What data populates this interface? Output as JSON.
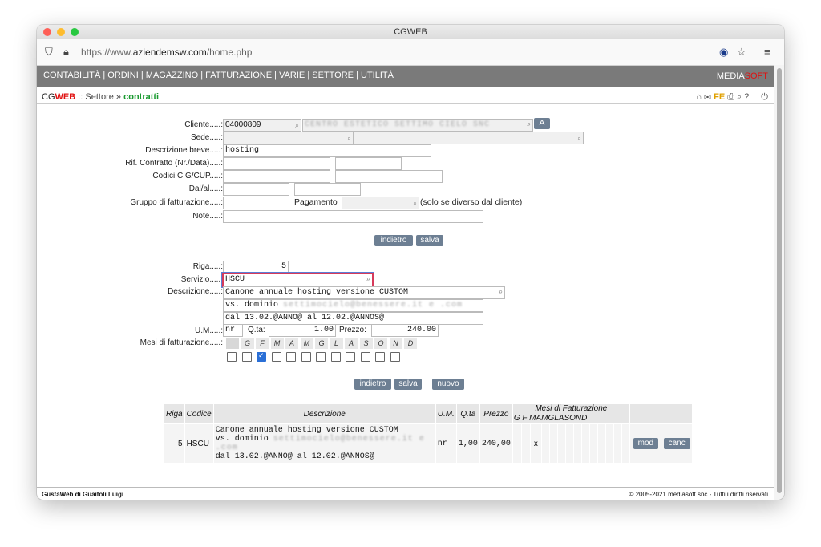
{
  "window": {
    "title": "CGWEB"
  },
  "browser": {
    "url_prefix": "https://www.",
    "url_domain": "aziendemsw.com",
    "url_path": "/home.php"
  },
  "menu": {
    "items": [
      "CONTABILITÀ",
      "ORDINI",
      "MAGAZZINO",
      "FATTURAZIONE",
      "VARIE",
      "SETTORE",
      "UTILITÀ"
    ],
    "brand_a": "MEDIA",
    "brand_b": "SOFT"
  },
  "breadcrumb": {
    "cg": "CG",
    "web": "WEB",
    "sep1": " :: ",
    "section": "Settore",
    "sep2": " » ",
    "current": "contratti"
  },
  "toolbar": {
    "fe": "FE"
  },
  "form": {
    "cliente_label": "Cliente.....:",
    "cliente_code": "04000809",
    "cliente_name": "CENTRO ESTETICO SETTIMO CIELO SNC",
    "cliente_btn": "A",
    "sede_label": "Sede.....:",
    "descr_label": "Descrizione breve.....:",
    "descr_value": "hosting",
    "rif_label": "Rif. Contratto (Nr./Data).....:",
    "cig_label": "Codici CIG/CUP.....:",
    "dal_label": "Dal/al.....:",
    "gruppo_label": "Gruppo di fatturazione.....:",
    "pagamento_label": "Pagamento",
    "pagamento_note": "(solo se diverso dal cliente)",
    "note_label": "Note.....:",
    "btn_indietro": "indietro",
    "btn_salva": "salva"
  },
  "riga": {
    "riga_label": "Riga.....:",
    "riga_value": "5",
    "servizio_label": "Servizio.....:",
    "servizio_value": "HSCU",
    "descr_label": "Descrizione.....:",
    "descr1": "Canone annuale hosting versione CUSTOM",
    "descr2_a": "vs. dominio ",
    "descr2_b": "settimocielo@benessere.it e .com",
    "descr3": "dal 13.02.@ANNO@ al 12.02.@ANNOS@",
    "um_label": "U.M.....:",
    "um_value": "nr",
    "qta_label": "Q.ta:",
    "qta_value": "1.00",
    "prezzo_label": "Prezzo:",
    "prezzo_value": "240.00",
    "mesi_label": "Mesi di fatturazione.....:",
    "mesi": [
      "G",
      "F",
      "M",
      "A",
      "M",
      "G",
      "L",
      "A",
      "S",
      "O",
      "N",
      "D"
    ],
    "mesi_checked": [
      false,
      false,
      true,
      false,
      false,
      false,
      false,
      false,
      false,
      false,
      false,
      false
    ],
    "btn_indietro": "indietro",
    "btn_salva": "salva",
    "btn_nuovo": "nuovo"
  },
  "table": {
    "headers": {
      "riga": "Riga",
      "codice": "Codice",
      "descrizione": "Descrizione",
      "um": "U.M.",
      "qta": "Q.ta",
      "prezzo": "Prezzo",
      "mesi": "Mesi di Fatturazione",
      "mesi_letters_a": "G",
      "mesi_letters_b": "F",
      "mesi_letters_c": "MAMGLASOND"
    },
    "row": {
      "riga": "5",
      "codice": "HSCU",
      "descr1": "Canone annuale hosting versione CUSTOM",
      "descr2_a": "vs. dominio ",
      "descr2_b": "settimocielo@benessere.it e .com",
      "descr3": "dal 13.02.@ANNO@ al 12.02.@ANNOS@",
      "um": "nr",
      "qta": "1,00",
      "prezzo": "240,00",
      "mark": "x",
      "btn_mod": "mod",
      "btn_canc": "canc"
    }
  },
  "footer": {
    "left": "GustaWeb di Guaitoli Luigi",
    "right": "© 2005-2021 mediasoft snc - Tutti i diritti riservati"
  }
}
